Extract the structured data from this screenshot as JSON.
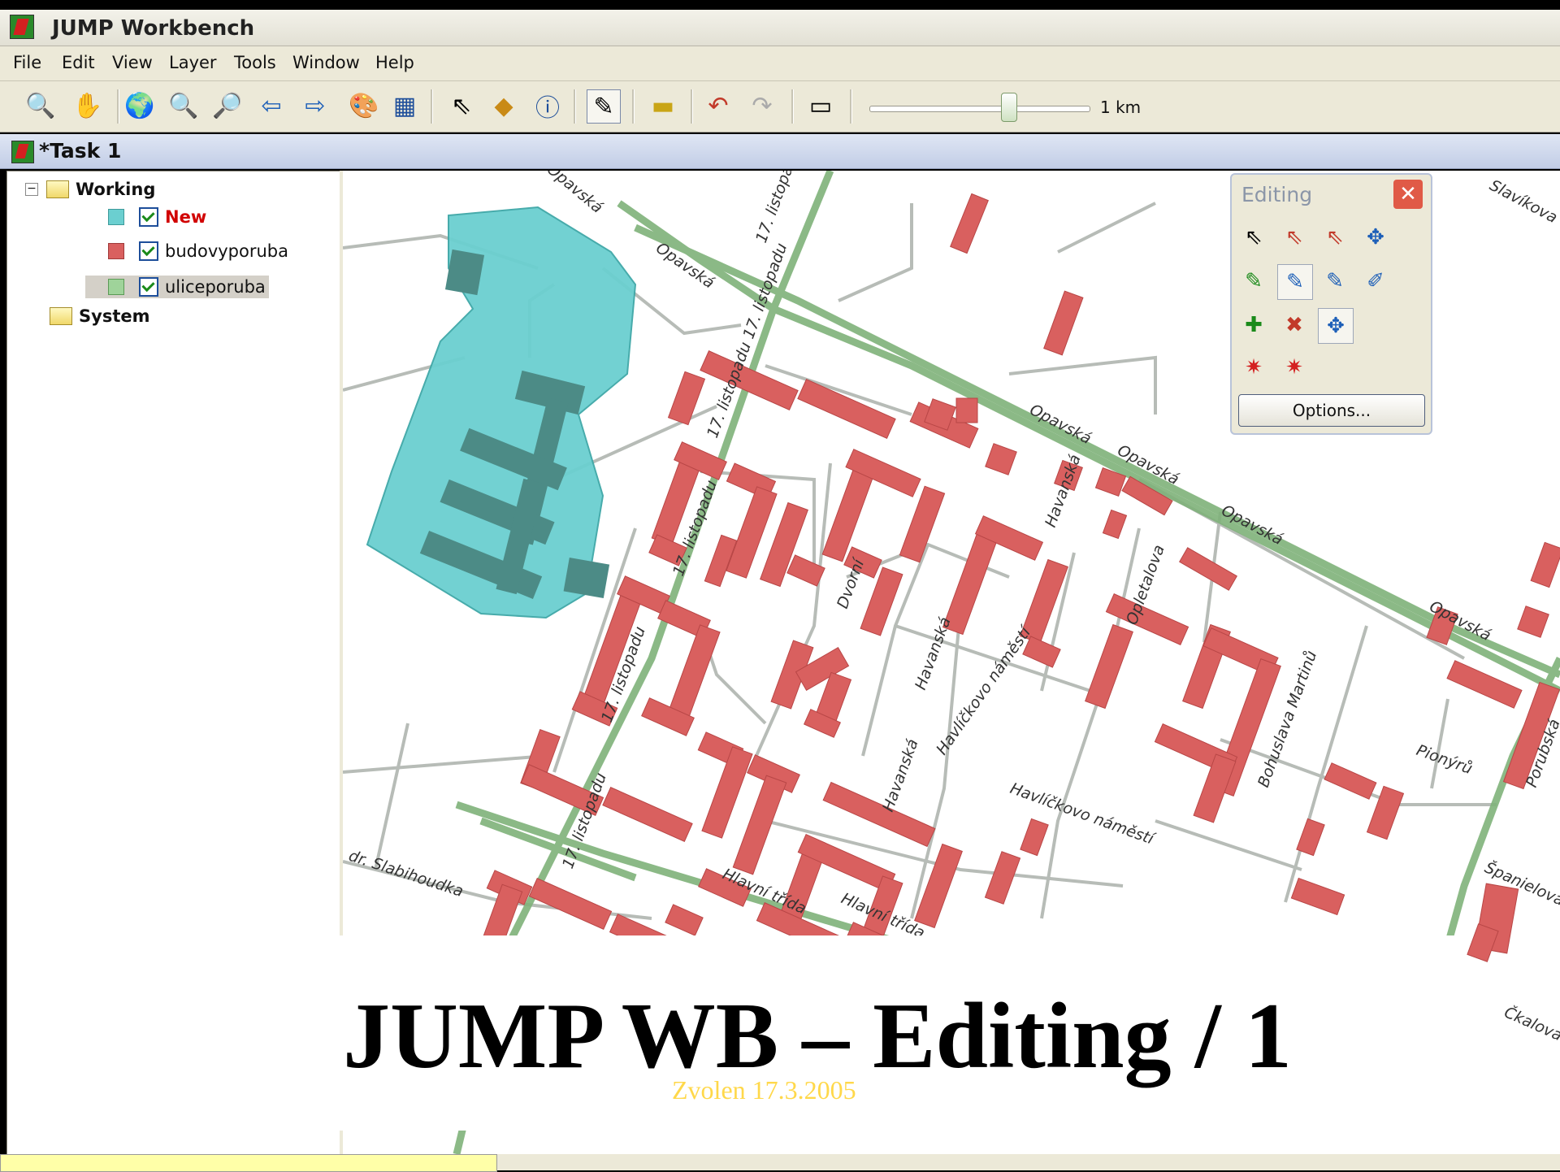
{
  "window": {
    "title": "JUMP Workbench"
  },
  "menu": [
    "File",
    "Edit",
    "View",
    "Layer",
    "Tools",
    "Window",
    "Help"
  ],
  "toolbar": {
    "scale_label": "1 km"
  },
  "task": {
    "title": "*Task 1"
  },
  "layers": {
    "working": "Working",
    "items": [
      {
        "name": "New",
        "color": "#6bcfd0"
      },
      {
        "name": "budovyporuba",
        "color": "#d9605f"
      },
      {
        "name": "uliceporuba",
        "color": "#7fb27a"
      }
    ],
    "system": "System"
  },
  "editing_panel": {
    "title": "Editing",
    "options_label": "Options..."
  },
  "map": {
    "labels": [
      "Opavská",
      "Opavská",
      "Opavská",
      "Opavská",
      "Opavská",
      "Opavská",
      "17. listopadu",
      "17. listopadu 17. listopadu",
      "17. listopadu",
      "17. listopadu",
      "17. listopadu",
      "Havanská",
      "Havanská",
      "Havanská",
      "Dvorní",
      "Opletalova",
      "Havlíčkovo náměstí",
      "Havlíčkovo náměstí",
      "Bohuslava Martinů",
      "Pionýrů",
      "Hlavní třída",
      "Hlavní třída",
      "dr. Slabihoudka",
      "Slavíkova",
      "Španielova",
      "Porubská",
      "Čkalova"
    ]
  },
  "slide": {
    "title": "JUMP WB – Editing / 1",
    "subtitle": "Zvolen 17.3.2005"
  }
}
